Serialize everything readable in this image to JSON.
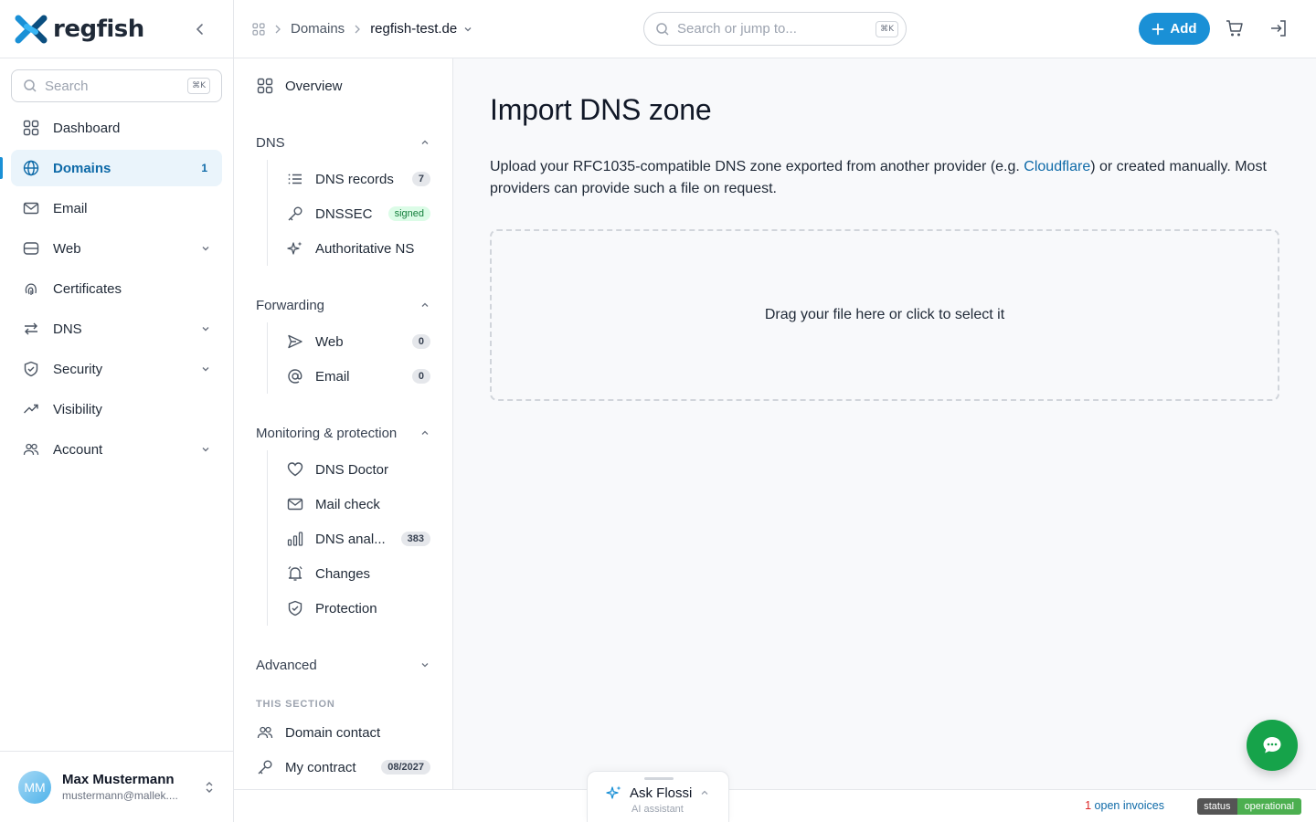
{
  "brand": {
    "name": "regfish"
  },
  "sidebar": {
    "search_placeholder": "Search",
    "shortcut": "⌘K",
    "items": [
      {
        "label": "Dashboard",
        "icon": "grid-icon"
      },
      {
        "label": "Domains",
        "icon": "globe-icon",
        "count": "1",
        "active": true
      },
      {
        "label": "Email",
        "icon": "mail-icon"
      },
      {
        "label": "Web",
        "icon": "server-icon",
        "expandable": true
      },
      {
        "label": "Certificates",
        "icon": "fingerprint-icon"
      },
      {
        "label": "DNS",
        "icon": "arrows-icon",
        "expandable": true
      },
      {
        "label": "Security",
        "icon": "shield-icon",
        "expandable": true
      },
      {
        "label": "Visibility",
        "icon": "trend-icon"
      },
      {
        "label": "Account",
        "icon": "users-icon",
        "expandable": true
      }
    ],
    "user": {
      "initials": "MM",
      "name": "Max Mustermann",
      "email": "mustermann@mallek...."
    }
  },
  "topbar": {
    "breadcrumb": [
      "Domains",
      "regfish-test.de"
    ],
    "search_placeholder": "Search or jump to...",
    "shortcut": "⌘K",
    "add_label": "Add"
  },
  "subnav": {
    "overview": "Overview",
    "dns": {
      "title": "DNS",
      "items": [
        {
          "label": "DNS records",
          "badge": "7"
        },
        {
          "label": "DNSSEC",
          "badge": "signed"
        },
        {
          "label": "Authoritative NS"
        }
      ]
    },
    "forwarding": {
      "title": "Forwarding",
      "items": [
        {
          "label": "Web",
          "badge": "0"
        },
        {
          "label": "Email",
          "badge": "0"
        }
      ]
    },
    "monitoring": {
      "title": "Monitoring & protection",
      "items": [
        {
          "label": "DNS Doctor"
        },
        {
          "label": "Mail check"
        },
        {
          "label": "DNS anal...",
          "badge": "383"
        },
        {
          "label": "Changes"
        },
        {
          "label": "Protection"
        }
      ]
    },
    "advanced": {
      "title": "Advanced"
    },
    "section_label": "THIS SECTION",
    "section_items": [
      {
        "label": "Domain contact"
      },
      {
        "label": "My contract",
        "badge": "08/2027"
      }
    ]
  },
  "main": {
    "title": "Import DNS zone",
    "desc_before": "Upload your RFC1035-compatible DNS zone exported from another provider (e.g. ",
    "desc_link": "Cloudflare",
    "desc_after": ") or created manually. Most providers can provide such a file on request.",
    "dropzone_text": "Drag your file here or click to select it"
  },
  "footer": {
    "invoice_count": "1",
    "invoice_text": " open invoices",
    "status_key": "status",
    "status_value": "operational"
  },
  "assistant": {
    "title": "Ask Flossi",
    "subtitle": "AI assistant"
  },
  "colors": {
    "accent": "#1a90d6",
    "link": "#0e6aa8",
    "chat": "#16a34a",
    "status_ok": "#4caf50"
  }
}
